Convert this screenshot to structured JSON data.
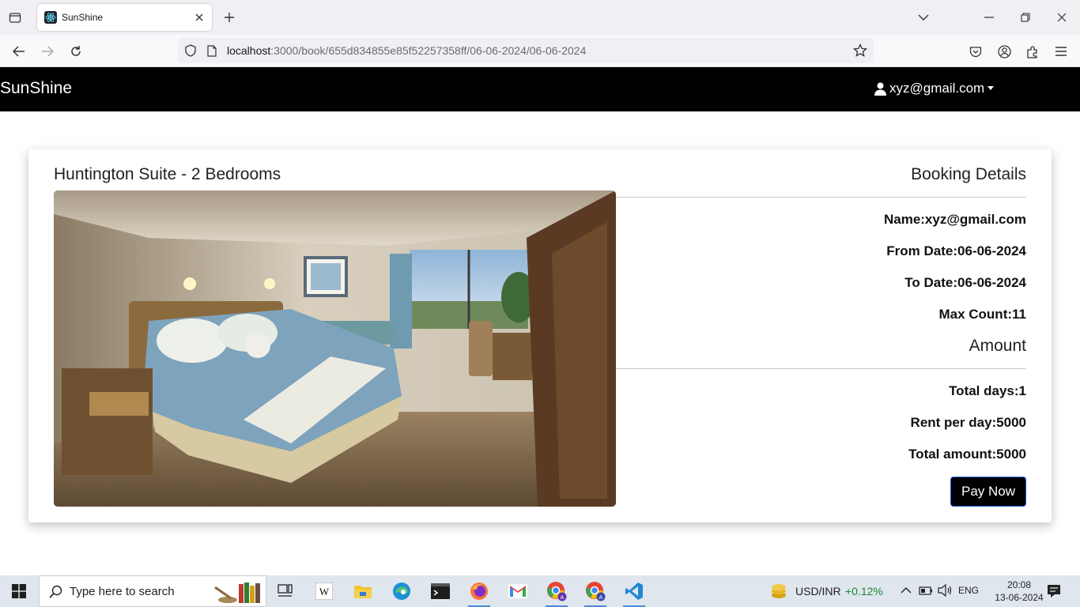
{
  "browser": {
    "tab_title": "SunShine",
    "url_host": "localhost",
    "url_rest": ":3000/book/655d834855e85f52257358ff/06-06-2024/06-06-2024"
  },
  "app": {
    "brand": "SunShine",
    "user_email": "xyz@gmail.com"
  },
  "room": {
    "title": "Huntington Suite - 2 Bedrooms"
  },
  "booking": {
    "heading": "Booking Details",
    "name": "Name:xyz@gmail.com",
    "from_date": "From Date:06-06-2024",
    "to_date": "To Date:06-06-2024",
    "max_count": "Max Count:11"
  },
  "amount": {
    "heading": "Amount",
    "total_days": "Total days:1",
    "rent_per_day": "Rent per day:5000",
    "total_amount": "Total amount:5000",
    "pay_label": "Pay Now"
  },
  "taskbar": {
    "search_placeholder": "Type here to search",
    "ticker": "USD/INR",
    "ticker_change": "+0.12%",
    "language": "ENG",
    "time": "20:08",
    "date": "13-06-2024"
  },
  "colors": {
    "navbar_bg": "#000000",
    "pay_button_bg": "#000000",
    "pay_button_border": "#1a5cd8",
    "ticker_positive": "#1a8a2a"
  }
}
